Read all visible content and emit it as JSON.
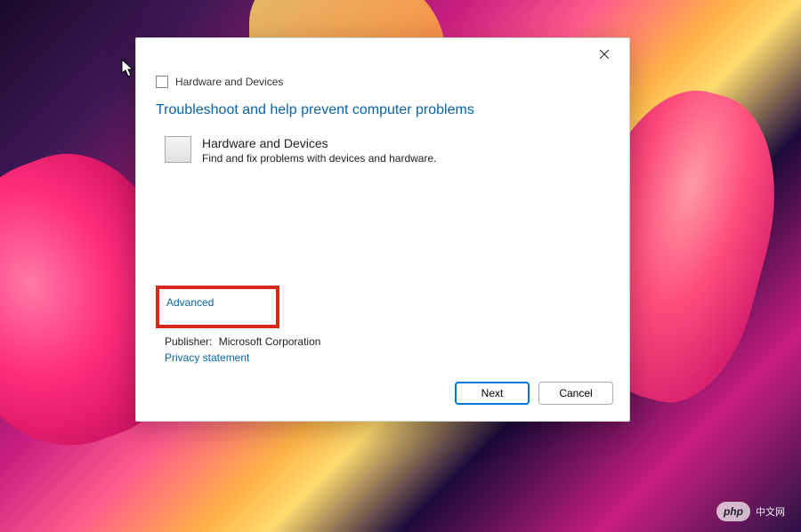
{
  "dialog": {
    "header_title": "Hardware and Devices",
    "main_heading": "Troubleshoot and help prevent computer problems",
    "section_heading": "Hardware and Devices",
    "section_description": "Find and fix problems with devices and hardware.",
    "advanced_link": "Advanced",
    "publisher_label": "Publisher:",
    "publisher_value": "Microsoft Corporation",
    "privacy_link": "Privacy statement",
    "next_button": "Next",
    "cancel_button": "Cancel"
  },
  "watermark": {
    "badge": "php",
    "text": "中文网"
  },
  "highlight": {
    "target": "advanced-link",
    "color": "#d8281a"
  }
}
